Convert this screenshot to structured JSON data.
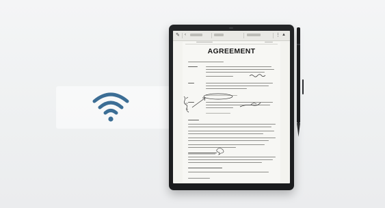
{
  "document": {
    "title": "AGREEMENT"
  },
  "colors": {
    "wifi": "#3c6e95",
    "device_bezel": "#1f2022",
    "screen": "#f3f3ef",
    "ink": "#2e2e2e"
  },
  "icons": [
    "wifi-icon",
    "pen-tool-icon",
    "menu-icon"
  ]
}
